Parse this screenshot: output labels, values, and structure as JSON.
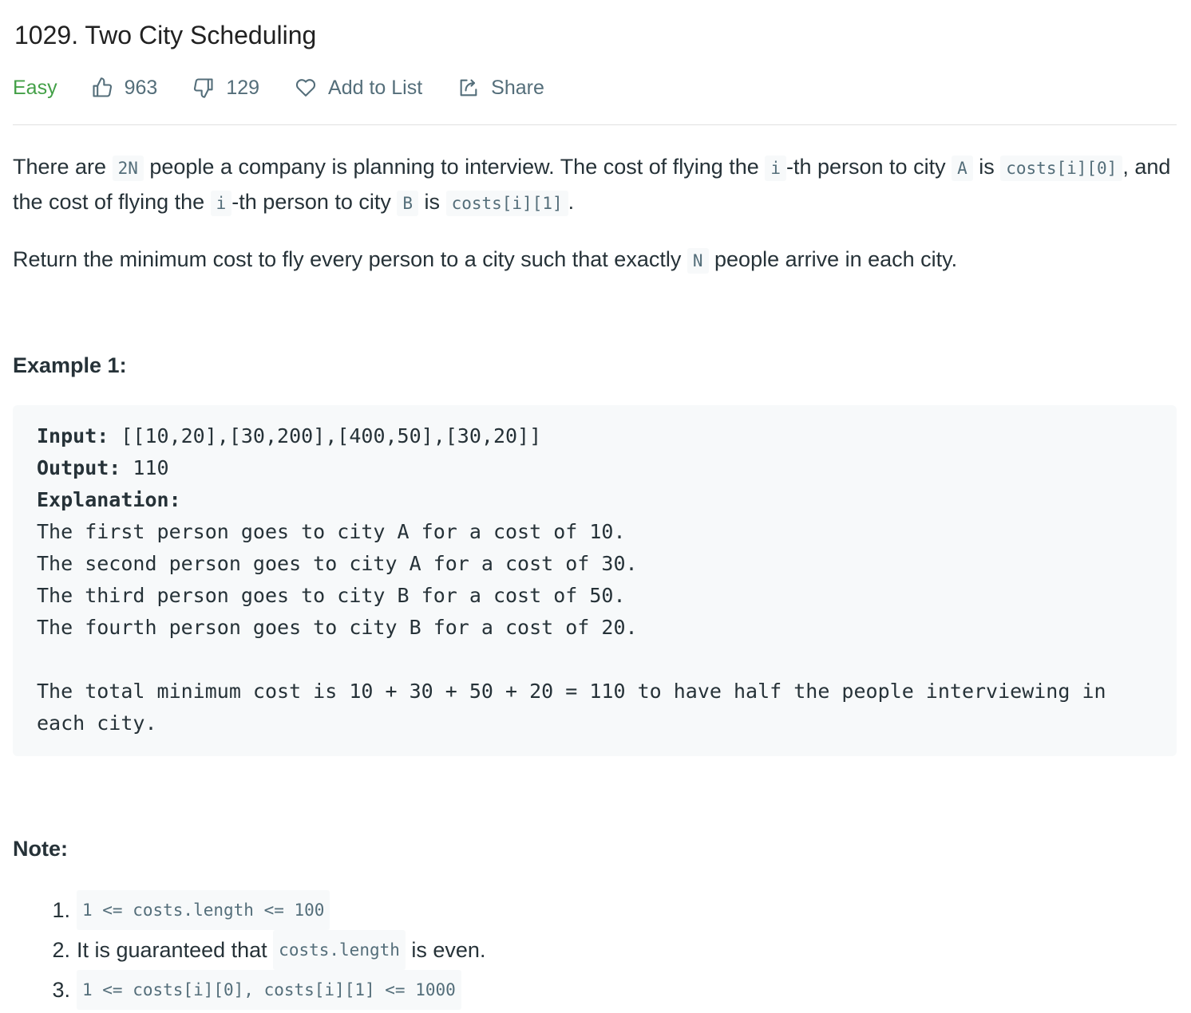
{
  "problem": {
    "title": "1029. Two City Scheduling",
    "difficulty": "Easy",
    "likes": "963",
    "dislikes": "129",
    "add_to_list": "Add to List",
    "share": "Share"
  },
  "description": {
    "p1": {
      "t1": "There are ",
      "c1": "2N",
      "t2": " people a company is planning to interview. The cost of flying the ",
      "c2": "i",
      "t3": "-th person to city ",
      "c3": "A",
      "t4": " is ",
      "c4": "costs[i][0]",
      "t5": ", and the cost of flying the ",
      "c5": "i",
      "t6": "-th person to city ",
      "c6": "B",
      "t7": " is ",
      "c7": "costs[i][1]",
      "t8": "."
    },
    "p2": {
      "t1": "Return the minimum cost to fly every person to a city such that exactly ",
      "c1": "N",
      "t2": " people arrive in each city."
    }
  },
  "example": {
    "heading": "Example 1:",
    "input_label": "Input:",
    "input_value": " [[10,20],[30,200],[400,50],[30,20]]",
    "output_label": "Output:",
    "output_value": " 110",
    "explanation_label": "Explanation:",
    "lines": [
      "The first person goes to city A for a cost of 10.",
      "The second person goes to city A for a cost of 30.",
      "The third person goes to city B for a cost of 50.",
      "The fourth person goes to city B for a cost of 20."
    ],
    "summary": "The total minimum cost is 10 + 30 + 50 + 20 = 110 to have half the people interviewing in each city."
  },
  "note": {
    "heading": "Note:",
    "items": [
      {
        "num": "1.",
        "pre": "",
        "code": "1 <= costs.length <= 100",
        "post": ""
      },
      {
        "num": "2.",
        "pre": "It is guaranteed that ",
        "code": "costs.length",
        "post": " is even."
      },
      {
        "num": "3.",
        "pre": "",
        "code": "1 <= costs[i][0], costs[i][1] <= 1000",
        "post": ""
      }
    ]
  }
}
